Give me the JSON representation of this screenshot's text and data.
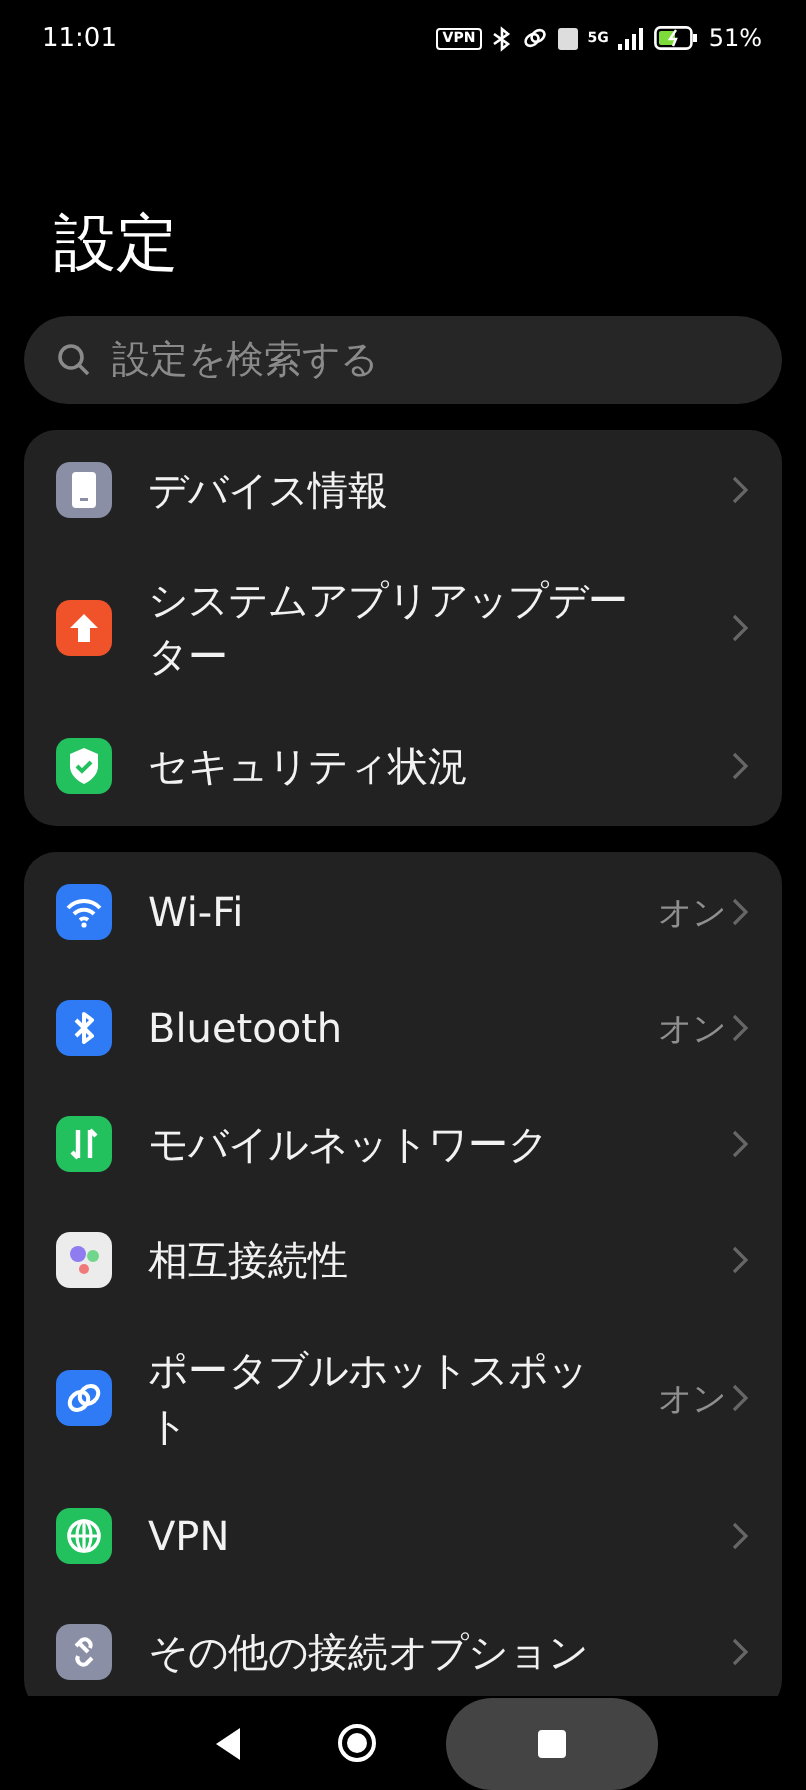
{
  "status_bar": {
    "time": "11:01",
    "vpn_badge": "VPN",
    "network": "5G",
    "battery_percent": "51%"
  },
  "title": "設定",
  "search": {
    "placeholder": "設定を検索する"
  },
  "groups": [
    {
      "items": [
        {
          "label": "デバイス情報"
        },
        {
          "label": "システムアプリアップデーター"
        },
        {
          "label": "セキュリティ状況"
        }
      ]
    },
    {
      "items": [
        {
          "label": "Wi-Fi",
          "value": "オン"
        },
        {
          "label": "Bluetooth",
          "value": "オン"
        },
        {
          "label": "モバイルネットワーク"
        },
        {
          "label": "相互接続性"
        },
        {
          "label": "ポータブルホットスポット",
          "value": "オン"
        },
        {
          "label": "VPN"
        },
        {
          "label": "その他の接続オプション"
        }
      ]
    }
  ],
  "nav_bar": {
    "buttons": [
      {
        "selected": false
      },
      {
        "selected": false
      },
      {
        "selected": true
      }
    ]
  }
}
